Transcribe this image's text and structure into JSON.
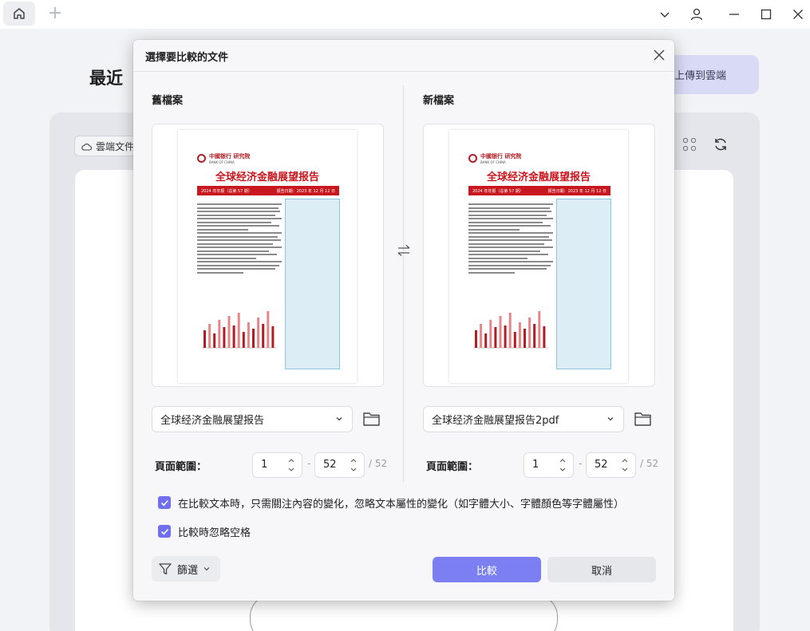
{
  "app": {
    "page_title": "最近",
    "upload_label": "上傳到雲端",
    "cloud_files_label": "雲端文件"
  },
  "dialog": {
    "title": "選擇要比較的文件",
    "old_heading": "舊檔案",
    "new_heading": "新檔案",
    "old_file": "全球经济金融展望报告",
    "new_file": "全球经济金融展望报告2pdf",
    "range_label": "頁面範圍：",
    "old_range": {
      "from": "1",
      "to": "52",
      "total": "/ 52"
    },
    "new_range": {
      "from": "1",
      "to": "52",
      "total": "/ 52"
    },
    "range_dash": "-",
    "option_text_only": "在比較文本時，只需關注內容的變化，忽略文本屬性的變化（如字體大小、字體顏色等字體屬性）",
    "option_ignore_space": "比較時忽略空格",
    "filter_label": "篩選",
    "compare_label": "比較",
    "cancel_label": "取消"
  },
  "preview": {
    "report_title": "全球经济金融展望报告",
    "band_left": "2024 年年报（总第 57 期）",
    "band_right": "报告日期：2023 年 12 月 12 日",
    "bank_name": "中國银行",
    "bank_sub": "研究院",
    "bank_en": "BANK OF CHINA"
  },
  "colors": {
    "accent": "#7b7ff2",
    "checkbox": "#6f6ff0",
    "report_red": "#c8171e"
  }
}
